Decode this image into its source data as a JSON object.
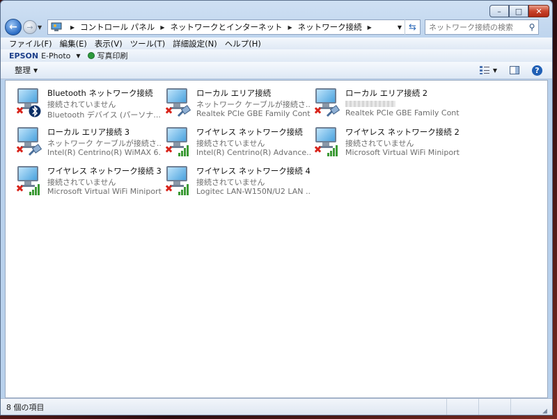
{
  "window": {
    "caption": {
      "minimize": "–",
      "maximize": "□",
      "close": "✕"
    }
  },
  "address": {
    "breadcrumbs": [
      "コントロール パネル",
      "ネットワークとインターネット",
      "ネットワーク接続"
    ]
  },
  "search": {
    "placeholder": "ネットワーク接続の検索"
  },
  "menubar": {
    "items": [
      "ファイル(F)",
      "編集(E)",
      "表示(V)",
      "ツール(T)",
      "詳細設定(N)",
      "ヘルプ(H)"
    ]
  },
  "epson_toolbar": {
    "brand": "EPSON",
    "app": "E-Photo",
    "photo_print": "写真印刷"
  },
  "command_bar": {
    "organize": "整理"
  },
  "connections": [
    {
      "name": "Bluetooth ネットワーク接続",
      "status": "接続されていません",
      "device": "Bluetooth デバイス (パーソナ...",
      "overlay": "bluetooth"
    },
    {
      "name": "ローカル エリア接続",
      "status": "ネットワーク ケーブルが接続さ...",
      "device": "Realtek PCIe GBE Family Cont...",
      "overlay": "cable"
    },
    {
      "name": "ローカル エリア接続 2",
      "status": "",
      "device": "Realtek PCIe GBE Family Cont...",
      "overlay": "cable",
      "status_blurred": true
    },
    {
      "name": "ローカル エリア接続 3",
      "status": "ネットワーク ケーブルが接続さ...",
      "device": "Intel(R) Centrino(R) WiMAX 6...",
      "overlay": "cable"
    },
    {
      "name": "ワイヤレス ネットワーク接続",
      "status": "接続されていません",
      "device": "Intel(R) Centrino(R) Advance...",
      "overlay": "signal"
    },
    {
      "name": "ワイヤレス ネットワーク接続 2",
      "status": "接続されていません",
      "device": "Microsoft Virtual WiFi Miniport...",
      "overlay": "signal"
    },
    {
      "name": "ワイヤレス ネットワーク接続 3",
      "status": "接続されていません",
      "device": "Microsoft Virtual WiFi Miniport...",
      "overlay": "signal"
    },
    {
      "name": "ワイヤレス ネットワーク接続 4",
      "status": "接続されていません",
      "device": "Logitec LAN-W150N/U2 LAN ...",
      "overlay": "signal"
    }
  ],
  "statusbar": {
    "text": "8 個の項目"
  }
}
